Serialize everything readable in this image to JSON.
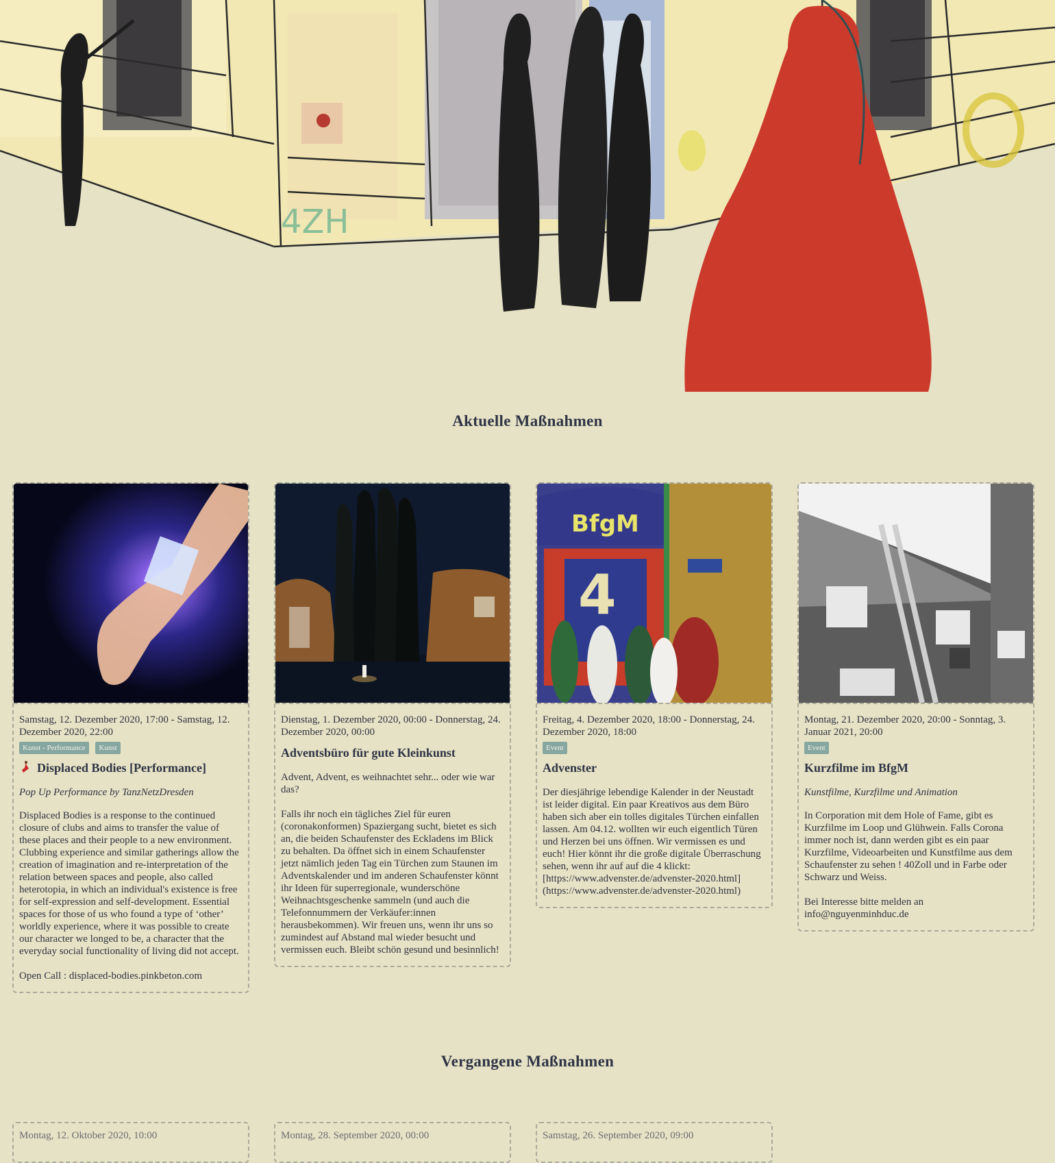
{
  "sections": {
    "current_title": "Aktuelle Maßnahmen",
    "past_title": "Vergangene Maßnahmen"
  },
  "events": [
    {
      "date": "Samstag, 12. Dezember 2020, 17:00 - Samstag, 12. Dezember 2020, 22:00",
      "tags": [
        "Kunst - Performance",
        "Kunst"
      ],
      "title": "Displaced Bodies [Performance]",
      "subtitle": "Pop Up Performance by TanzNetzDresden",
      "paragraphs": [
        "Displaced Bodies is a response to the continued closure of clubs and aims to transfer the value of these places and their people to a new environment. Clubbing experience and similar gatherings allow the creation of imagination and re-interpretation of the relation between spaces and people, also called heterotopia, in which an individual's existence is free for self-expression and self-development. Essential spaces for those of us who found a type of ‘other’ worldly experience, where it was possible to create our character we longed to be, a character that the everyday social functionality of living did not accept.",
        "Open Call : displaced-bodies.pinkbeton.com"
      ],
      "image_icon": "glowing-wrist-icon"
    },
    {
      "date": "Dienstag, 1. Dezember 2020, 00:00 - Donnerstag, 24. Dezember 2020, 00:00",
      "tags": [],
      "title": "Adventsbüro für gute Kleinkunst",
      "subtitle": "",
      "paragraphs": [
        "Advent, Advent, es weihnachtet sehr... oder wie war das?",
        "Falls ihr noch ein tägliches Ziel für euren (coronakonformen) Spaziergang sucht, bietet es sich an, die beiden Schaufenster des Eckladens im Blick zu behalten. Da öffnet sich in einem Schaufenster jetzt nämlich jeden Tag ein Türchen zum Staunen im Adventskalender und im anderen Schaufenster könnt ihr Ideen für superregionale, wunderschöne Weihnachtsgeschenke sammeln (und auch die Telefonnummern der Verkäufer:innen herausbekommen). Wir freuen uns, wenn ihr uns so zumindest auf Abstand mal wieder besucht und vermissen euch. Bleibt schön gesund und besinnlich!"
      ],
      "image_icon": "island-painting-icon"
    },
    {
      "date": "Freitag, 4. Dezember 2020, 18:00 - Donnerstag, 24. Dezember 2020, 18:00",
      "tags": [
        "Event"
      ],
      "title": "Advenster",
      "subtitle": "",
      "paragraphs": [
        "Der diesjährige lebendige Kalender in der Neustadt ist leider digital. Ein paar Kreativos aus dem Büro haben sich aber ein tolles digitales Türchen einfallen lassen. Am 04.12. wollten wir euch eigentlich Türen und Herzen bei uns öffnen. Wir vermissen es und euch! Hier könnt ihr die große digitale Überraschung sehen, wenn ihr auf auf die 4 klickt: [https://www.advenster.de/advenster-2020.html](https://www.advenster.de/advenster-2020.html)"
      ],
      "image_icon": "bfgm-door-painting-icon"
    },
    {
      "date": "Montag, 21. Dezember 2020, 20:00 - Sonntag, 3. Januar 2021, 20:00",
      "tags": [
        "Event"
      ],
      "title": "Kurzfilme im BfgM",
      "subtitle": "Kunstfilme, Kurzfilme und Animation",
      "paragraphs": [
        "In Corporation mit dem Hole of Fame, gibt es Kurzfilme im Loop und Glühwein. Falls Corona immer noch ist, dann werden gibt es ein paar Kurzfilme, Videoarbeiten und Kunstfilme aus dem Schaufenster zu sehen ! 40Zoll und in Farbe oder Schwarz und Weiss.",
        "Bei Interesse bitte melden an info@nguyenminhduc.de"
      ],
      "image_icon": "house-ladder-photo-icon"
    }
  ],
  "past_events": [
    {
      "date": "Montag, 12. Oktober 2020, 10:00"
    },
    {
      "date": "Montag, 28. September 2020, 00:00"
    },
    {
      "date": "Samstag, 26. September 2020, 09:00"
    }
  ],
  "colors": {
    "background": "#e6e2c5",
    "heading": "#2e3446",
    "tag": "#86a6a0",
    "border": "#aaa99b"
  }
}
